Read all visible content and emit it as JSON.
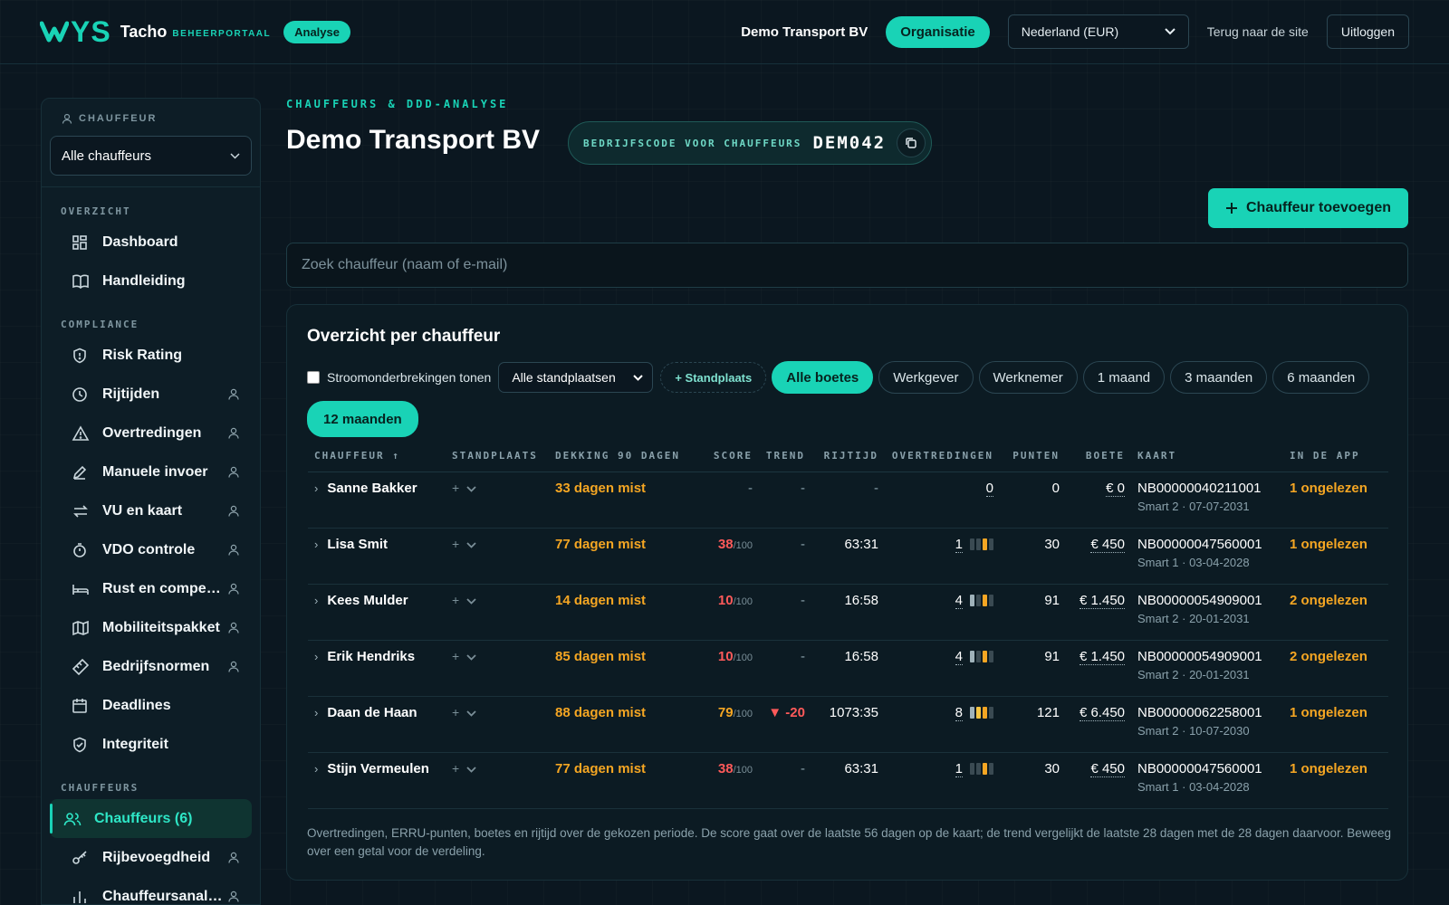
{
  "header": {
    "logo_text": "YS",
    "app_name": "Tacho",
    "app_sub": "BEHEERPORTAAL",
    "badge": "Analyse",
    "org_name": "Demo Transport BV",
    "org_button": "Organisatie",
    "country": "Nederland (EUR)",
    "back_link": "Terug naar de site",
    "logout": "Uitloggen"
  },
  "sidebar": {
    "driver_label": "CHAUFFEUR",
    "driver_select": "Alle chauffeurs",
    "sections": [
      {
        "title": "OVERZICHT",
        "items": [
          {
            "label": "Dashboard",
            "icon": "grid-icon",
            "user": false
          },
          {
            "label": "Handleiding",
            "icon": "book-icon",
            "user": false
          }
        ]
      },
      {
        "title": "COMPLIANCE",
        "items": [
          {
            "label": "Risk Rating",
            "icon": "shield-icon",
            "user": false
          },
          {
            "label": "Rijtijden",
            "icon": "clock-icon",
            "user": true
          },
          {
            "label": "Overtredingen",
            "icon": "warning-icon",
            "user": true
          },
          {
            "label": "Manuele invoer",
            "icon": "pencil-icon",
            "user": true
          },
          {
            "label": "VU en kaart",
            "icon": "arrows-icon",
            "user": true
          },
          {
            "label": "VDO controle",
            "icon": "stopwatch-icon",
            "user": true
          },
          {
            "label": "Rust en compen…",
            "icon": "bed-icon",
            "user": true
          },
          {
            "label": "Mobiliteitspakket",
            "icon": "map-icon",
            "user": true
          },
          {
            "label": "Bedrijfsnormen",
            "icon": "ruler-icon",
            "user": true
          },
          {
            "label": "Deadlines",
            "icon": "calendar-icon",
            "user": false
          },
          {
            "label": "Integriteit",
            "icon": "shield-check-icon",
            "user": false
          }
        ]
      },
      {
        "title": "CHAUFFEURS",
        "items": [
          {
            "label": "Chauffeurs (6)",
            "icon": "users-icon",
            "user": false,
            "active": true
          },
          {
            "label": "Rijbevoegdheid",
            "icon": "key-icon",
            "user": true
          },
          {
            "label": "Chauffeursanaly…",
            "icon": "chart-icon",
            "user": true
          }
        ]
      }
    ]
  },
  "main": {
    "crumb": "CHAUFFEURS & DDD-ANALYSE",
    "title": "Demo Transport BV",
    "code_label": "BEDRIJFSCODE VOOR CHAUFFEURS",
    "code_value": "DEM042",
    "add_button": "Chauffeur toevoegen",
    "search_placeholder": "Zoek chauffeur (naam of e-mail)"
  },
  "overview": {
    "title": "Overzicht per chauffeur",
    "checkbox_label": "Stroomonderbrekingen tonen",
    "standplaats_select": "Alle standplaatsen",
    "add_standplaats": "+ Standplaats",
    "chips": [
      {
        "label": "Alle boetes",
        "on": true
      },
      {
        "label": "Werkgever",
        "on": false
      },
      {
        "label": "Werknemer",
        "on": false
      },
      {
        "label": "1 maand",
        "on": false
      },
      {
        "label": "3 maanden",
        "on": false
      },
      {
        "label": "6 maanden",
        "on": false
      },
      {
        "label": "12 maanden",
        "on": true
      }
    ],
    "columns": [
      "CHAUFFEUR ↑",
      "STANDPLAATS",
      "DEKKING 90 DAGEN",
      "SCORE",
      "TREND",
      "RIJTIJD",
      "OVERTREDINGEN",
      "PUNTEN",
      "BOETE",
      "KAART",
      "IN DE APP"
    ],
    "score_suffix": "/100",
    "rows": [
      {
        "name": "Sanne Bakker",
        "coverage": "33 dagen mist",
        "score": "",
        "score_level": "none",
        "trend": "-",
        "rijtijd": "-",
        "overtredingen": "0",
        "bars": [],
        "punten": "0",
        "boete": "€ 0",
        "kaart": "NB00000040211001",
        "kaart_sub": "Smart 2 · 07-07-2031",
        "app": "1 ongelezen"
      },
      {
        "name": "Lisa Smit",
        "coverage": "77 dagen mist",
        "score": "38",
        "score_level": "red",
        "trend": "-",
        "rijtijd": "63:31",
        "overtredingen": "1",
        "bars": [
          "#3a4a52",
          "#3a4a52",
          "#f5a623",
          "#3a4a52"
        ],
        "punten": "30",
        "boete": "€ 450",
        "kaart": "NB00000047560001",
        "kaart_sub": "Smart 1 · 03-04-2028",
        "app": "1 ongelezen"
      },
      {
        "name": "Kees Mulder",
        "coverage": "14 dagen mist",
        "score": "10",
        "score_level": "red",
        "trend": "-",
        "rijtijd": "16:58",
        "overtredingen": "4",
        "bars": [
          "#9fb2ba",
          "#3a4a52",
          "#f5a623",
          "#3a4a52"
        ],
        "punten": "91",
        "boete": "€ 1.450",
        "kaart": "NB00000054909001",
        "kaart_sub": "Smart 2 · 20-01-2031",
        "app": "2 ongelezen"
      },
      {
        "name": "Erik Hendriks",
        "coverage": "85 dagen mist",
        "score": "10",
        "score_level": "red",
        "trend": "-",
        "rijtijd": "16:58",
        "overtredingen": "4",
        "bars": [
          "#9fb2ba",
          "#3a4a52",
          "#f5a623",
          "#3a4a52"
        ],
        "punten": "91",
        "boete": "€ 1.450",
        "kaart": "NB00000054909001",
        "kaart_sub": "Smart 2 · 20-01-2031",
        "app": "2 ongelezen"
      },
      {
        "name": "Daan de Haan",
        "coverage": "88 dagen mist",
        "score": "79",
        "score_level": "amber",
        "trend": "▼ -20",
        "rijtijd": "1073:35",
        "overtredingen": "8",
        "bars": [
          "#9fb2ba",
          "#f5c542",
          "#f5a623",
          "#3a4a52"
        ],
        "punten": "121",
        "boete": "€ 6.450",
        "kaart": "NB00000062258001",
        "kaart_sub": "Smart 2 · 10-07-2030",
        "app": "1 ongelezen"
      },
      {
        "name": "Stijn Vermeulen",
        "coverage": "77 dagen mist",
        "score": "38",
        "score_level": "red",
        "trend": "-",
        "rijtijd": "63:31",
        "overtredingen": "1",
        "bars": [
          "#3a4a52",
          "#3a4a52",
          "#f5a623",
          "#3a4a52"
        ],
        "punten": "30",
        "boete": "€ 450",
        "kaart": "NB00000047560001",
        "kaart_sub": "Smart 1 · 03-04-2028",
        "app": "1 ongelezen"
      }
    ],
    "footnote": "Overtredingen, ERRU-punten, boetes en rijtijd over de gekozen periode. De score gaat over de laatste 56 dagen op de kaart; de trend vergelijkt de laatste 28 dagen met de 28 dagen daarvoor. Beweeg over een getal voor de verdeling."
  },
  "colors": {
    "accent": "#19d3b6",
    "warning": "#f5a623",
    "danger": "#ff5a5a",
    "background": "#0b1720"
  }
}
